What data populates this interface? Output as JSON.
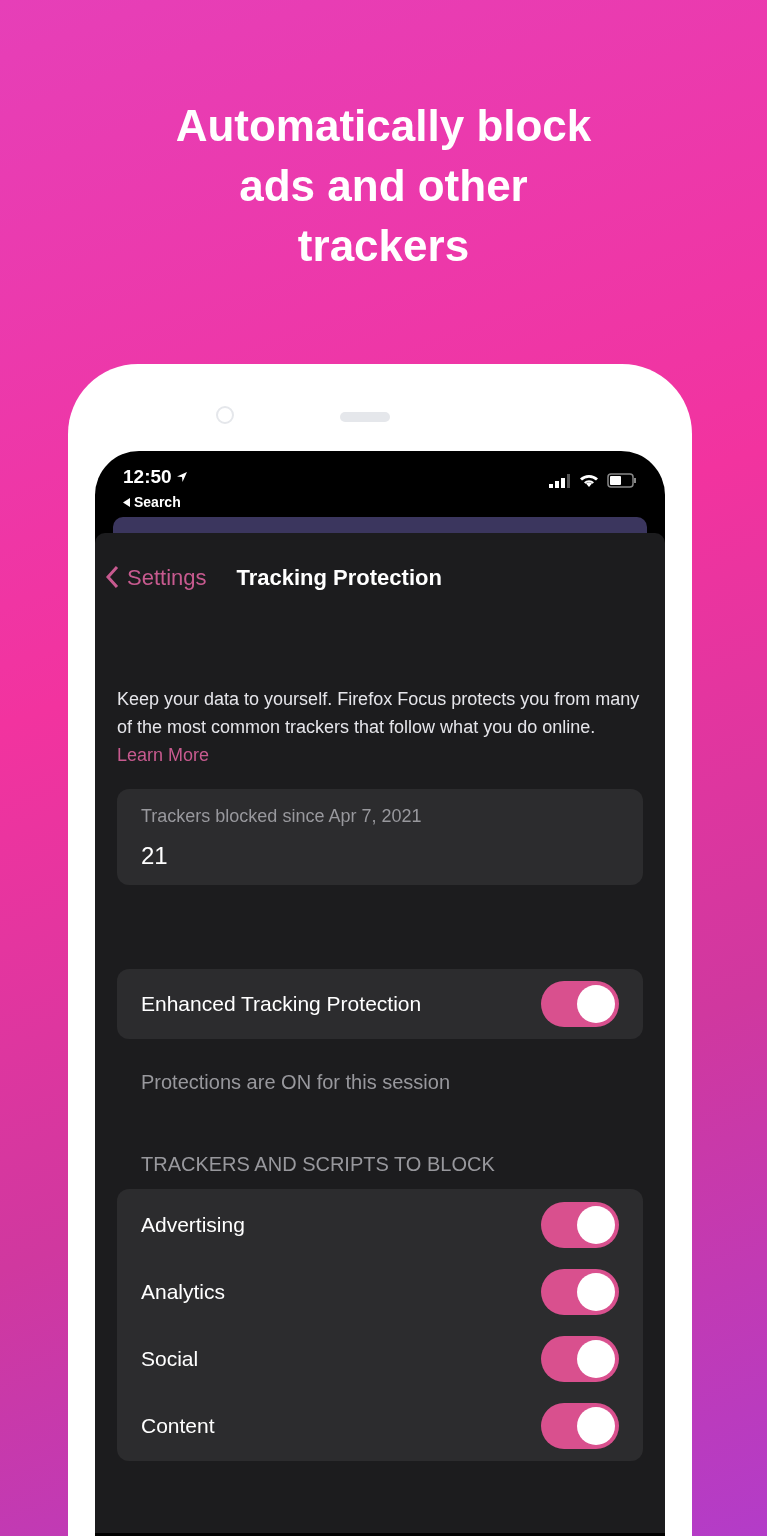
{
  "headline": "Automatically block ads and other trackers",
  "status_bar": {
    "time": "12:50",
    "back_app": "Search"
  },
  "nav": {
    "back": "Settings",
    "title": "Tracking Protection"
  },
  "description": "Keep your data to yourself. Firefox Focus protects you from many of the most common trackers that follow what you do online.",
  "learn_more": "Learn More",
  "stats": {
    "label": "Trackers blocked since Apr 7, 2021",
    "value": "21"
  },
  "enhanced": {
    "label": "Enhanced Tracking Protection",
    "on": true
  },
  "note": "Protections are ON for this session",
  "section_header": "TRACKERS AND SCRIPTS TO BLOCK",
  "trackers": [
    {
      "label": "Advertising",
      "on": true
    },
    {
      "label": "Analytics",
      "on": true
    },
    {
      "label": "Social",
      "on": true
    },
    {
      "label": "Content",
      "on": true
    }
  ]
}
